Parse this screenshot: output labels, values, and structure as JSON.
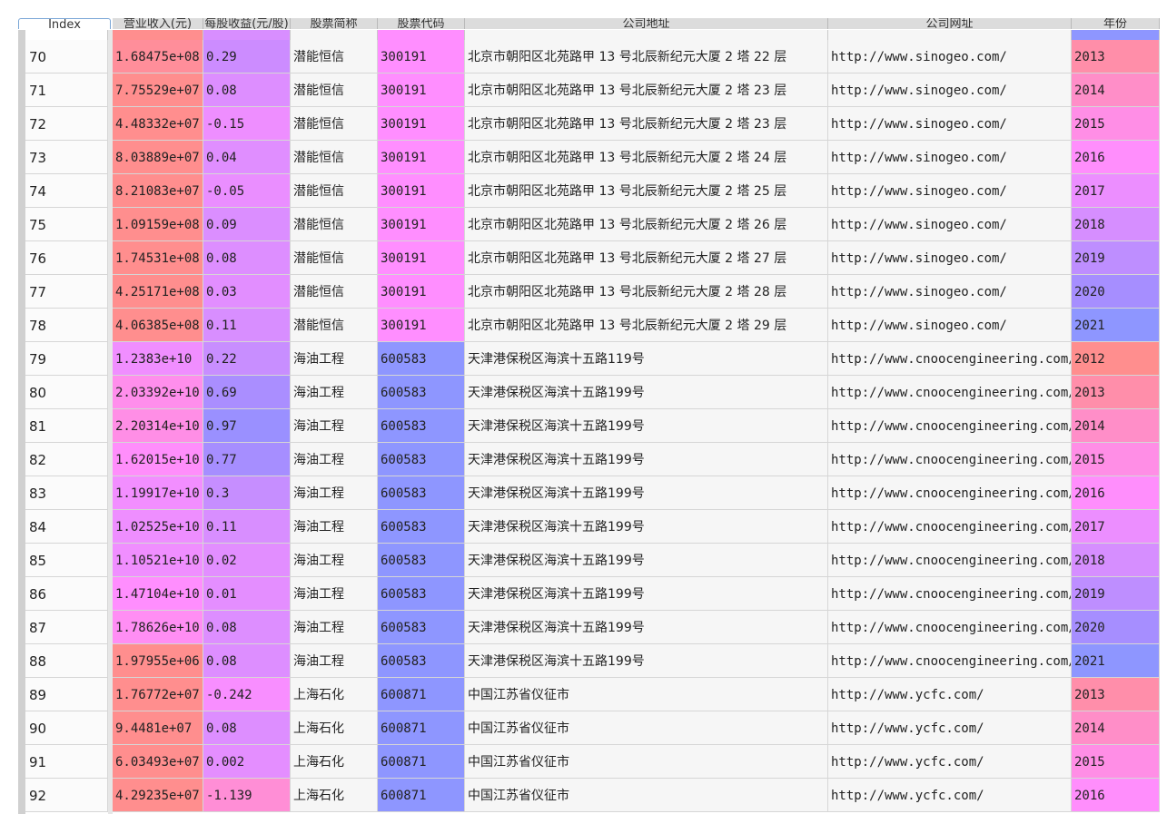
{
  "columns": [
    {
      "key": "index",
      "label": "Index"
    },
    {
      "key": "revenue",
      "label": "营业收入(元)"
    },
    {
      "key": "eps",
      "label": "每股收益(元/股)"
    },
    {
      "key": "name",
      "label": "股票简称"
    },
    {
      "key": "code",
      "label": "股票代码"
    },
    {
      "key": "address",
      "label": "公司地址"
    },
    {
      "key": "website",
      "label": "公司网址"
    },
    {
      "key": "year",
      "label": "年份"
    }
  ],
  "rows": [
    {
      "index": "70",
      "revenue": "1.68475e+08",
      "eps": "0.29",
      "name": "潜能恒信",
      "code": "300191",
      "address": "北京市朝阳区北苑路甲 13 号北辰新纪元大厦 2 塔 22 层",
      "website": "http://www.sinogeo.com/",
      "year": "2013",
      "rev_color": "#ff8e9a",
      "eps_color": "#cc8cff",
      "code_color": "#ff8eff",
      "year_color": "#ff8ea9"
    },
    {
      "index": "71",
      "revenue": "7.75529e+07",
      "eps": "0.08",
      "name": "潜能恒信",
      "code": "300191",
      "address": "北京市朝阳区北苑路甲 13 号北辰新纪元大厦 2 塔 23 层",
      "website": "http://www.sinogeo.com/",
      "year": "2014",
      "rev_color": "#ff8e8e",
      "eps_color": "#dd8eff",
      "code_color": "#ff8eff",
      "year_color": "#ff8ec8"
    },
    {
      "index": "72",
      "revenue": "4.48332e+07",
      "eps": "-0.15",
      "name": "潜能恒信",
      "code": "300191",
      "address": "北京市朝阳区北苑路甲 13 号北辰新纪元大厦 2 塔 23 层",
      "website": "http://www.sinogeo.com/",
      "year": "2015",
      "rev_color": "#ff8e8e",
      "eps_color": "#ee8eff",
      "code_color": "#ff8eff",
      "year_color": "#ff8ee6"
    },
    {
      "index": "73",
      "revenue": "8.03889e+07",
      "eps": "0.04",
      "name": "潜能恒信",
      "code": "300191",
      "address": "北京市朝阳区北苑路甲 13 号北辰新纪元大厦 2 塔 24 层",
      "website": "http://www.sinogeo.com/",
      "year": "2016",
      "rev_color": "#ff8e8e",
      "eps_color": "#e08eff",
      "code_color": "#ff8eff",
      "year_color": "#ff8efc"
    },
    {
      "index": "74",
      "revenue": "8.21083e+07",
      "eps": "-0.05",
      "name": "潜能恒信",
      "code": "300191",
      "address": "北京市朝阳区北苑路甲 13 号北辰新纪元大厦 2 塔 25 层",
      "website": "http://www.sinogeo.com/",
      "year": "2017",
      "rev_color": "#ff8e8e",
      "eps_color": "#ea8eff",
      "code_color": "#ff8eff",
      "year_color": "#ec8eff"
    },
    {
      "index": "75",
      "revenue": "1.09159e+08",
      "eps": "0.09",
      "name": "潜能恒信",
      "code": "300191",
      "address": "北京市朝阳区北苑路甲 13 号北辰新纪元大厦 2 塔 26 层",
      "website": "http://www.sinogeo.com/",
      "year": "2018",
      "rev_color": "#ff8e8e",
      "eps_color": "#db8eff",
      "code_color": "#ff8eff",
      "year_color": "#d68eff"
    },
    {
      "index": "76",
      "revenue": "1.74531e+08",
      "eps": "0.08",
      "name": "潜能恒信",
      "code": "300191",
      "address": "北京市朝阳区北苑路甲 13 号北辰新纪元大厦 2 塔 27 层",
      "website": "http://www.sinogeo.com/",
      "year": "2019",
      "rev_color": "#ff8e8e",
      "eps_color": "#dd8eff",
      "code_color": "#ff8eff",
      "year_color": "#be8eff"
    },
    {
      "index": "77",
      "revenue": "4.25171e+08",
      "eps": "0.03",
      "name": "潜能恒信",
      "code": "300191",
      "address": "北京市朝阳区北苑路甲 13 号北辰新纪元大厦 2 塔 28 层",
      "website": "http://www.sinogeo.com/",
      "year": "2020",
      "rev_color": "#ff8e8e",
      "eps_color": "#e28eff",
      "code_color": "#ff8eff",
      "year_color": "#a68eff"
    },
    {
      "index": "78",
      "revenue": "4.06385e+08",
      "eps": "0.11",
      "name": "潜能恒信",
      "code": "300191",
      "address": "北京市朝阳区北苑路甲 13 号北辰新纪元大厦 2 塔 29 层",
      "website": "http://www.sinogeo.com/",
      "year": "2021",
      "rev_color": "#ff8e8e",
      "eps_color": "#d88eff",
      "code_color": "#ff8eff",
      "year_color": "#8e96ff"
    },
    {
      "index": "79",
      "revenue": "1.2383e+10",
      "eps": "0.22",
      "name": "海油工程",
      "code": "600583",
      "address": "天津港保税区海滨十五路119号",
      "website": "http://www.cnoocengineering.com/",
      "year": "2012",
      "rev_color": "#f08eff",
      "eps_color": "#c88eff",
      "code_color": "#8e96ff",
      "year_color": "#ff8e8e"
    },
    {
      "index": "80",
      "revenue": "2.03392e+10",
      "eps": "0.69",
      "name": "海油工程",
      "code": "600583",
      "address": "天津港保税区海滨十五路199号",
      "website": "http://www.cnoocengineering.com/",
      "year": "2013",
      "rev_color": "#ff8eec",
      "eps_color": "#aa8eff",
      "code_color": "#8e96ff",
      "year_color": "#ff8eaa"
    },
    {
      "index": "81",
      "revenue": "2.20314e+10",
      "eps": "0.97",
      "name": "海油工程",
      "code": "600583",
      "address": "天津港保税区海滨十五路199号",
      "website": "http://www.cnoocengineering.com/",
      "year": "2014",
      "rev_color": "#ff8ee6",
      "eps_color": "#9a90ff",
      "code_color": "#8e96ff",
      "year_color": "#ff8ec8"
    },
    {
      "index": "82",
      "revenue": "1.62015e+10",
      "eps": "0.77",
      "name": "海油工程",
      "code": "600583",
      "address": "天津港保税区海滨十五路199号",
      "website": "http://www.cnoocengineering.com/",
      "year": "2015",
      "rev_color": "#ff8efb",
      "eps_color": "#a68eff",
      "code_color": "#8e96ff",
      "year_color": "#ff8ee6"
    },
    {
      "index": "83",
      "revenue": "1.19917e+10",
      "eps": "0.3",
      "name": "海油工程",
      "code": "600583",
      "address": "天津港保税区海滨十五路199号",
      "website": "http://www.cnoocengineering.com/",
      "year": "2016",
      "rev_color": "#f28eff",
      "eps_color": "#c68eff",
      "code_color": "#8e96ff",
      "year_color": "#ff8efc"
    },
    {
      "index": "84",
      "revenue": "1.02525e+10",
      "eps": "0.11",
      "name": "海油工程",
      "code": "600583",
      "address": "天津港保税区海滨十五路199号",
      "website": "http://www.cnoocengineering.com/",
      "year": "2017",
      "rev_color": "#ee8eff",
      "eps_color": "#d88eff",
      "code_color": "#8e96ff",
      "year_color": "#ec8eff"
    },
    {
      "index": "85",
      "revenue": "1.10521e+10",
      "eps": "0.02",
      "name": "海油工程",
      "code": "600583",
      "address": "天津港保税区海滨十五路199号",
      "website": "http://www.cnoocengineering.com/",
      "year": "2018",
      "rev_color": "#f08eff",
      "eps_color": "#e28eff",
      "code_color": "#8e96ff",
      "year_color": "#d68eff"
    },
    {
      "index": "86",
      "revenue": "1.47104e+10",
      "eps": "0.01",
      "name": "海油工程",
      "code": "600583",
      "address": "天津港保税区海滨十五路199号",
      "website": "http://www.cnoocengineering.com/",
      "year": "2019",
      "rev_color": "#ff8efe",
      "eps_color": "#e48eff",
      "code_color": "#8e96ff",
      "year_color": "#be8eff"
    },
    {
      "index": "87",
      "revenue": "1.78626e+10",
      "eps": "0.08",
      "name": "海油工程",
      "code": "600583",
      "address": "天津港保税区海滨十五路199号",
      "website": "http://www.cnoocengineering.com/",
      "year": "2020",
      "rev_color": "#ff8ef4",
      "eps_color": "#dd8eff",
      "code_color": "#8e96ff",
      "year_color": "#a68eff"
    },
    {
      "index": "88",
      "revenue": "1.97955e+06",
      "eps": "0.08",
      "name": "海油工程",
      "code": "600583",
      "address": "天津港保税区海滨十五路199号",
      "website": "http://www.cnoocengineering.com/",
      "year": "2021",
      "rev_color": "#ff8e8e",
      "eps_color": "#dd8eff",
      "code_color": "#8e96ff",
      "year_color": "#8e96ff"
    },
    {
      "index": "89",
      "revenue": "1.76772e+07",
      "eps": "-0.242",
      "name": "上海石化",
      "code": "600871",
      "address": "中国江苏省仪征市",
      "website": "http://www.ycfc.com/",
      "year": "2013",
      "rev_color": "#ff8e8e",
      "eps_color": "#f88eff",
      "code_color": "#8e96ff",
      "year_color": "#ff8eaa"
    },
    {
      "index": "90",
      "revenue": "9.4481e+07",
      "eps": "0.08",
      "name": "上海石化",
      "code": "600871",
      "address": "中国江苏省仪征市",
      "website": "http://www.ycfc.com/",
      "year": "2014",
      "rev_color": "#ff8e8e",
      "eps_color": "#dd8eff",
      "code_color": "#8e96ff",
      "year_color": "#ff8ec8"
    },
    {
      "index": "91",
      "revenue": "6.03493e+07",
      "eps": "0.002",
      "name": "上海石化",
      "code": "600871",
      "address": "中国江苏省仪征市",
      "website": "http://www.ycfc.com/",
      "year": "2015",
      "rev_color": "#ff8e8e",
      "eps_color": "#e48eff",
      "code_color": "#8e96ff",
      "year_color": "#ff8ee6"
    },
    {
      "index": "92",
      "revenue": "4.29235e+07",
      "eps": "-1.139",
      "name": "上海石化",
      "code": "600871",
      "address": "中国江苏省仪征市",
      "website": "http://www.ycfc.com/",
      "year": "2016",
      "rev_color": "#ff8e8e",
      "eps_color": "#ff8ed6",
      "code_color": "#8e96ff",
      "year_color": "#ff8efc"
    }
  ],
  "header_strip_colors": {
    "revenue": "#ff8e8e",
    "eps": "#d88eff",
    "code": "#ff8eff",
    "year": "#8e96ff"
  },
  "plain_color": "#f6f6f6"
}
